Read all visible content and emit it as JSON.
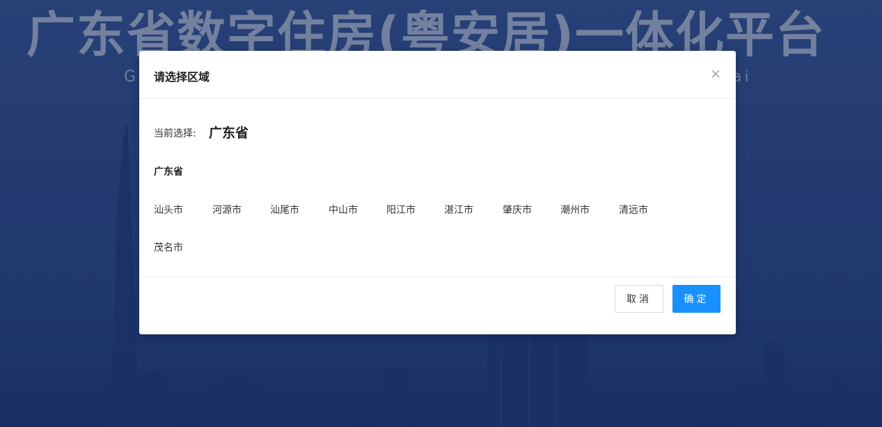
{
  "background": {
    "title": "广东省数字住房(粤安居)一体化平台",
    "subtitle_left": "G",
    "subtitle_right": "ai"
  },
  "modal": {
    "title": "请选择区域",
    "current_label": "当前选择:",
    "current_value": "广东省",
    "province": "广东省",
    "cities": [
      "汕头市",
      "河源市",
      "汕尾市",
      "中山市",
      "阳江市",
      "湛江市",
      "肇庆市",
      "潮州市",
      "清远市",
      "茂名市"
    ],
    "cancel_label": "取消",
    "ok_label": "确定"
  },
  "colors": {
    "primary": "#1890ff",
    "background_blue": "#2a4480"
  },
  "icons": {
    "close": "close-icon"
  }
}
